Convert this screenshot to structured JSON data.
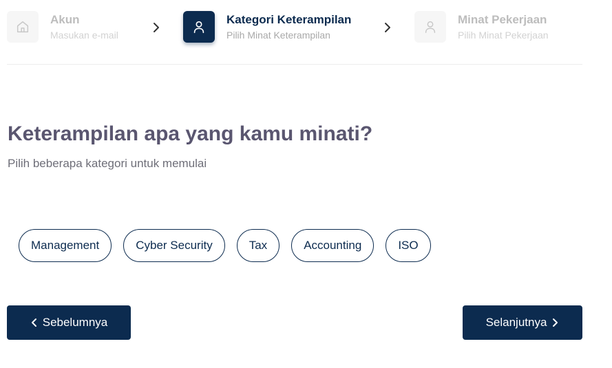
{
  "stepper": {
    "steps": [
      {
        "title": "Akun",
        "subtitle": "Masukan e-mail",
        "icon": "home-icon",
        "state": "done"
      },
      {
        "title": "Kategori Keterampilan",
        "subtitle": "Pilih Minat Keterampilan",
        "icon": "user-icon",
        "state": "current"
      },
      {
        "title": "Minat Pekerjaan",
        "subtitle": "Pilih Minat Pekerjaan",
        "icon": "user-icon",
        "state": "todo"
      }
    ]
  },
  "main": {
    "heading": "Keterampilan apa yang kamu minati?",
    "subheading": "Pilih beberapa kategori untuk memulai",
    "categories": [
      "Management",
      "Cyber Security",
      "Tax",
      "Accounting",
      "ISO"
    ]
  },
  "nav": {
    "prev_label": "Sebelumnya",
    "next_label": "Selanjutnya"
  },
  "colors": {
    "primary": "#0c2b4f",
    "heading": "#5a5670",
    "muted": "#bdbdbd"
  }
}
